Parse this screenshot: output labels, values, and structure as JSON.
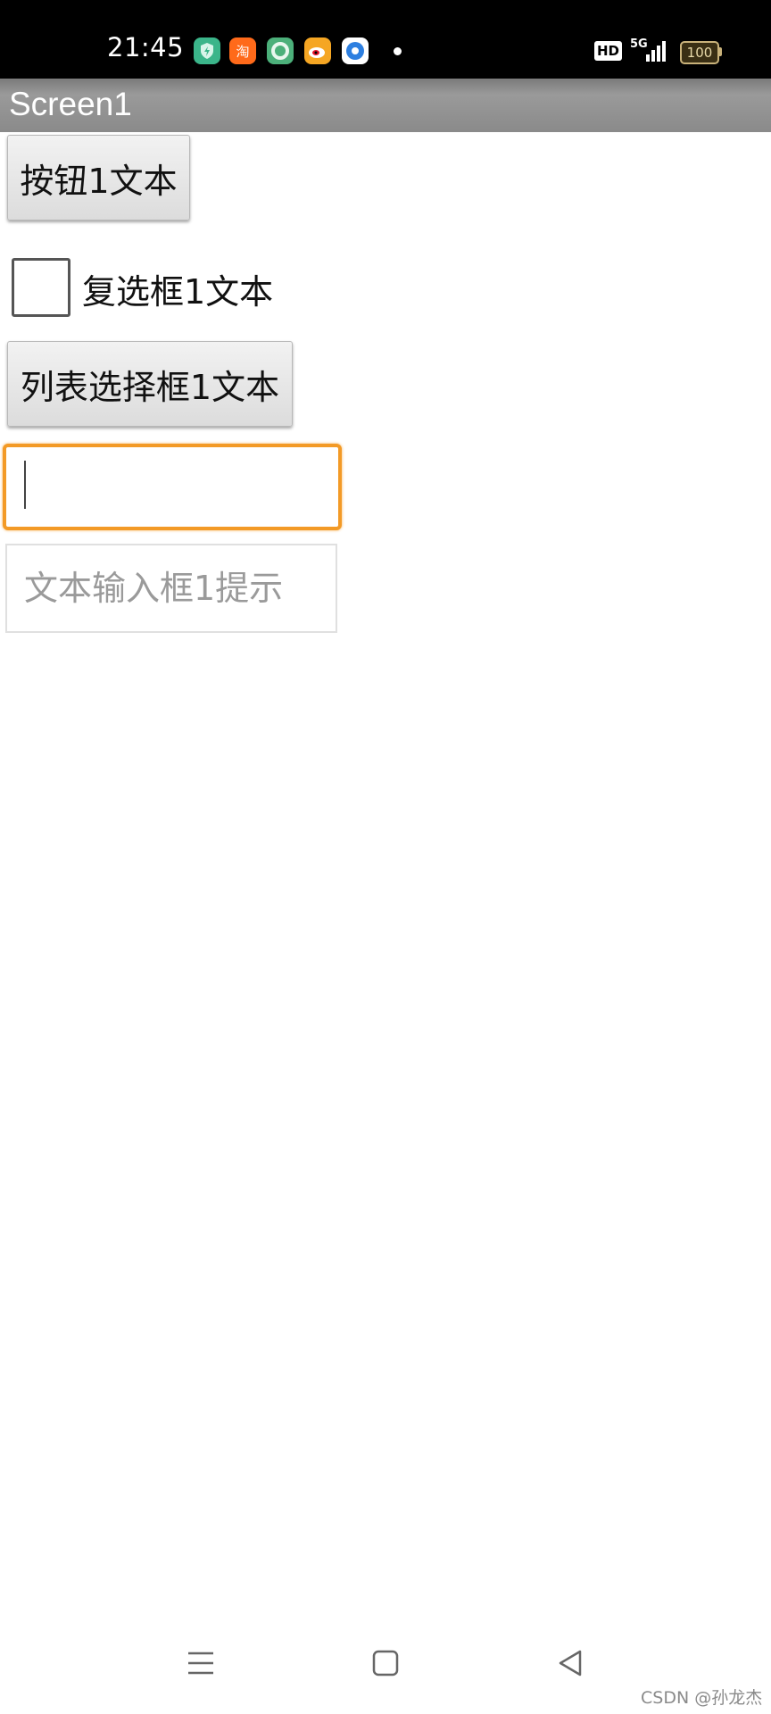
{
  "status_bar": {
    "time": "21:45",
    "notification_icons": [
      {
        "name": "security-shield-app-icon",
        "color": "#3bb58a"
      },
      {
        "name": "taobao-app-icon",
        "color": "#ff6a1a"
      },
      {
        "name": "green-circle-app-icon",
        "color": "#4cb07a"
      },
      {
        "name": "weibo-app-icon",
        "color": "#f5a623"
      },
      {
        "name": "blue-circle-app-icon",
        "color": "#2d7fe0"
      }
    ],
    "hd_label": "HD",
    "network_label": "5G",
    "battery_level": "100"
  },
  "title_bar": {
    "title": "Screen1"
  },
  "form": {
    "button1_label": "按钮1文本",
    "checkbox1_label": "复选框1文本",
    "checkbox1_checked": false,
    "listpicker1_label": "列表选择框1文本",
    "textbox1_value": "",
    "textbox2_value": "",
    "textbox2_placeholder": "文本输入框1提示"
  },
  "nav_bar": {
    "items": [
      "menu-icon",
      "home-icon",
      "back-icon"
    ]
  },
  "watermark": "CSDN @孙龙杰",
  "colors": {
    "status_bar_bg": "#000000",
    "title_bar_bg": "#8a8a8a",
    "focus_accent": "#f39a26"
  }
}
